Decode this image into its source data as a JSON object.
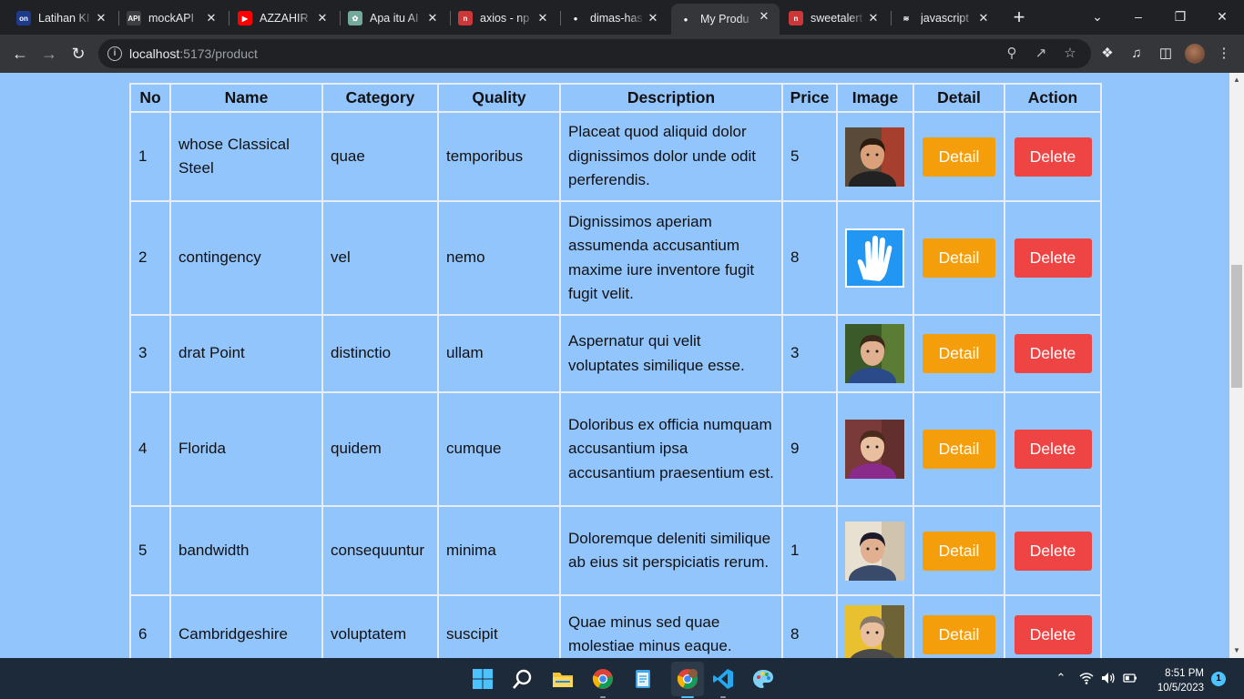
{
  "browser": {
    "tabs": [
      {
        "title": "Latihan KI",
        "favicon_color": "#1e3a8a",
        "favicon_glyph": "on"
      },
      {
        "title": "mockAPI",
        "favicon_color": "#3c4043",
        "favicon_glyph": "API"
      },
      {
        "title": "AZZAHIR",
        "favicon_color": "#ff0000",
        "favicon_glyph": "▶"
      },
      {
        "title": "Apa itu AI",
        "favicon_color": "#74aa9c",
        "favicon_glyph": "✿"
      },
      {
        "title": "axios - np",
        "favicon_color": "#cb3837",
        "favicon_glyph": "n"
      },
      {
        "title": "dimas-has",
        "favicon_color": "#202124",
        "favicon_glyph": "●"
      },
      {
        "title": "My Produ",
        "favicon_color": "#35363a",
        "favicon_glyph": "●",
        "active": true
      },
      {
        "title": "sweetalert",
        "favicon_color": "#cb3837",
        "favicon_glyph": "n"
      },
      {
        "title": "javascript",
        "favicon_color": "#202124",
        "favicon_glyph": "≋"
      }
    ],
    "url_host": "localhost",
    "url_rest": ":5173/product",
    "icons": {
      "back": "arrow-left-icon",
      "forward": "arrow-right-icon",
      "reload": "reload-icon",
      "zoom": "zoom-icon",
      "share": "share-icon",
      "bookmark": "star-icon",
      "extensions": "puzzle-icon",
      "media": "media-icon",
      "sidepanel": "side-panel-icon"
    }
  },
  "table": {
    "headers": [
      "No",
      "Name",
      "Category",
      "Quality",
      "Description",
      "Price",
      "Image",
      "Detail",
      "Action"
    ],
    "detail_label": "Detail",
    "delete_label": "Delete",
    "rows": [
      {
        "no": "1",
        "name": "whose Classical Steel",
        "category": "quae",
        "quality": "temporibus",
        "description": "Placeat quod aliquid dolor dignissimos dolor unde odit perferendis.",
        "price": "5",
        "image": "avatar-photo-1"
      },
      {
        "no": "2",
        "name": "contingency",
        "category": "vel",
        "quality": "nemo",
        "description": "Dignissimos aperiam assumenda accusantium maxime iure inventore fugit fugit velit.",
        "price": "8",
        "image": "hand-icon-image"
      },
      {
        "no": "3",
        "name": "drat Point",
        "category": "distinctio",
        "quality": "ullam",
        "description": "Aspernatur qui velit voluptates similique esse.",
        "price": "3",
        "image": "avatar-photo-2"
      },
      {
        "no": "4",
        "name": "Florida",
        "category": "quidem",
        "quality": "cumque",
        "description": "Doloribus ex officia numquam accusantium ipsa accusantium praesentium est.",
        "price": "9",
        "image": "avatar-photo-3"
      },
      {
        "no": "5",
        "name": "bandwidth",
        "category": "consequuntur",
        "quality": "minima",
        "description": "Doloremque deleniti similique ab eius sit perspiciatis rerum.",
        "price": "1",
        "image": "avatar-photo-4"
      },
      {
        "no": "6",
        "name": "Cambridgeshire",
        "category": "voluptatem",
        "quality": "suscipit",
        "description": "Quae minus sed quae molestiae minus eaque.",
        "price": "8",
        "image": "avatar-photo-5"
      }
    ]
  },
  "colors": {
    "page_bg": "#93c5fd",
    "detail_button": "#f59e0b",
    "delete_button": "#ef4444"
  },
  "taskbar": {
    "time": "8:51 PM",
    "date": "10/5/2023",
    "notifications": "1"
  }
}
